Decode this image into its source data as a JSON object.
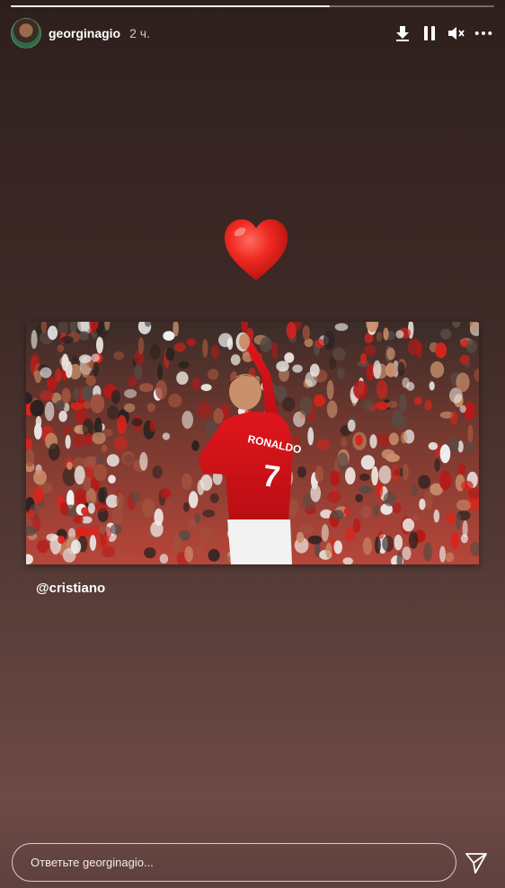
{
  "story": {
    "progress_fraction": 0.66,
    "username": "georginagio",
    "time_ago": "2 ч.",
    "caption": "@cristiano",
    "heart_emoji": "heart-emoji"
  },
  "photo": {
    "description_icon": "football-crowd-photo",
    "shirt_name": "RONALDO",
    "shirt_number": "7"
  },
  "controls": {
    "icons": [
      "download-icon",
      "pause-icon",
      "mute-icon",
      "more-icon"
    ]
  },
  "reply": {
    "placeholder": "Ответьте georginagio..."
  },
  "colors": {
    "accent_red": "#e0161c",
    "text": "#ffffff"
  }
}
